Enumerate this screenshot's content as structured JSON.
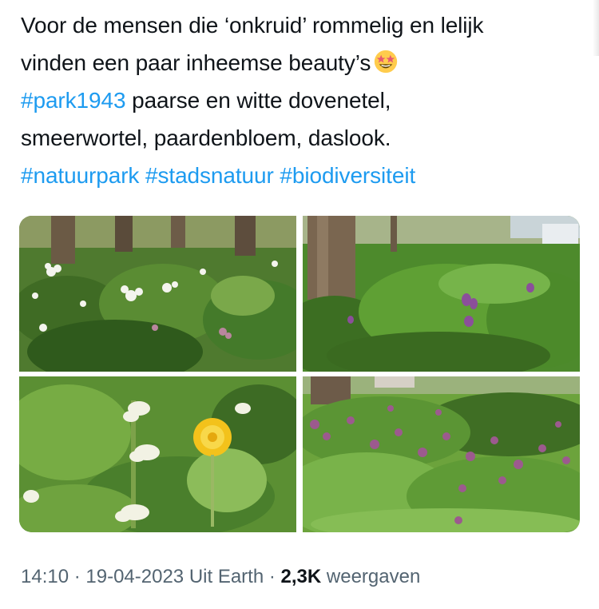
{
  "tweet": {
    "line1": "Voor de mensen die ‘onkruid’ rommelig en lelijk",
    "line2": "vinden een paar inheemse beauty’s",
    "line2_emoji": "star-struck-emoji",
    "line3_hashtag": "#park1943",
    "line3_text": " paarse en witte dovenetel,",
    "line4": "smeerwortel, paardenbloem, daslook.",
    "hashtags": [
      "#natuurpark",
      "#stadsnatuur",
      "#biodiversiteit"
    ]
  },
  "media": {
    "photos": [
      {
        "subject": "white wild garlic flowers and comfrey"
      },
      {
        "subject": "comfrey with purple bell flowers near tree"
      },
      {
        "subject": "white dead-nettle and dandelion"
      },
      {
        "subject": "purple dead-nettle ground cover"
      }
    ]
  },
  "meta": {
    "time": "14:10",
    "sep1": " · ",
    "date": "19-04-2023",
    "source": " Uit Earth",
    "sep2": " · ",
    "views_count": "2,3K",
    "views_label": " weergaven"
  },
  "colors": {
    "text": "#0f1419",
    "hashtag": "#1d9bf0",
    "meta": "#536471"
  }
}
